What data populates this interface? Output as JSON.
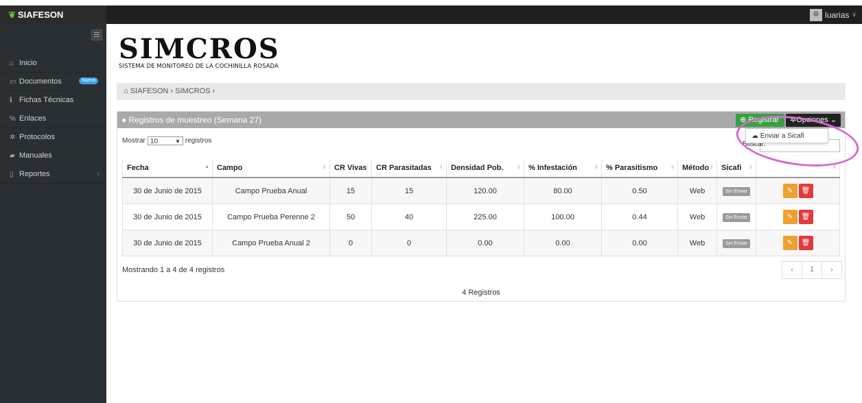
{
  "topbar": {
    "brand": "SIAFESON",
    "user": "luarias"
  },
  "sidebar": {
    "items": [
      {
        "label": "Inicio",
        "icon": "home-icon"
      },
      {
        "label": "Documentos",
        "icon": "folder-icon",
        "badge": "Nuevo"
      },
      {
        "label": "Fichas Técnicas",
        "icon": "info-icon"
      },
      {
        "label": "Enlaces",
        "icon": "link-icon"
      },
      {
        "label": "Protocolos",
        "icon": "gear-icon"
      },
      {
        "label": "Manuales",
        "icon": "book-icon"
      },
      {
        "label": "Reportes",
        "icon": "file-icon"
      }
    ]
  },
  "logo": {
    "title": "SIMCROS",
    "subtitle": "SISTEMA DE MONITOREO DE LA COCHINILLA ROSADA"
  },
  "breadcrumb": {
    "home": "SIAFESON",
    "current": "SIMCROS"
  },
  "panel": {
    "title": "Registros de muestreo (Semana 27)",
    "register_label": "Registrar",
    "options_label": "Opciones",
    "dropdown_item": "Enviar a Sicafi",
    "show_prefix": "Mostrar",
    "show_value": "10",
    "show_suffix": "registros",
    "search_label": "Buscar:"
  },
  "table": {
    "headers": [
      "Fecha",
      "Campo",
      "CR Vivas",
      "CR Parasitadas",
      "Densidad Pob.",
      "% Infestación",
      "% Parasitismo",
      "Método",
      "Sicafi",
      ""
    ],
    "rows": [
      {
        "fecha": "30 de Junio de 2015",
        "campo": "Campo Prueba Anual",
        "vivas": "15",
        "parasitadas": "15",
        "densidad": "120.00",
        "infestacion": "80.00",
        "parasitismo": "0.50",
        "metodo": "Web",
        "sicafi": "Sin Enviar"
      },
      {
        "fecha": "30 de Junio de 2015",
        "campo": "Campo Prueba Perenne 2",
        "vivas": "50",
        "parasitadas": "40",
        "densidad": "225.00",
        "infestacion": "100.00",
        "parasitismo": "0.44",
        "metodo": "Web",
        "sicafi": "Sin Enviar"
      },
      {
        "fecha": "30 de Junio de 2015",
        "campo": "Campo Prueba Anual 2",
        "vivas": "0",
        "parasitadas": "0",
        "densidad": "0.00",
        "infestacion": "0.00",
        "parasitismo": "0.00",
        "metodo": "Web",
        "sicafi": "Sin Enviar"
      }
    ]
  },
  "info_text": "Mostrando 1 a 4 de 4 registros",
  "pager": {
    "prev": "‹",
    "page": "1",
    "next": "›"
  },
  "footer_count": "4 Registros",
  "colors": {
    "register": "#3aa043",
    "edit": "#f0a030",
    "delete": "#e23b3b",
    "highlight": "#d668d6"
  }
}
